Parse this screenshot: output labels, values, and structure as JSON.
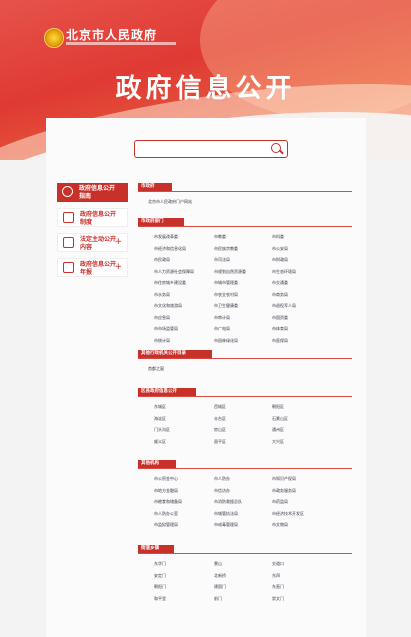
{
  "header": {
    "site_name": "北京市人民政府",
    "page_title": "政府信息公开"
  },
  "search": {
    "placeholder": ""
  },
  "sidebar": {
    "items": [
      {
        "label": "政府信息公开指南",
        "active": true,
        "expand": ""
      },
      {
        "label": "政府信息公开制度",
        "active": false,
        "expand": ""
      },
      {
        "label": "法定主动公开内容",
        "active": false,
        "expand": "+"
      },
      {
        "label": "政府信息公开年报",
        "active": false,
        "expand": "+"
      }
    ]
  },
  "sections": [
    {
      "title": "市政府",
      "items": [
        "北京市人民政府门户网站"
      ]
    },
    {
      "title": "市政府部门",
      "items": [
        "市发展改革委",
        "市教委",
        "市科委",
        "市经济和信息化局",
        "市民族宗教委",
        "市公安局",
        "市民政局",
        "市司法局",
        "市财政局",
        "市人力资源社会保障局",
        "市规划自然资源委",
        "市生态环境局",
        "市住房城乡建设委",
        "市城市管理委",
        "市交通委",
        "市水务局",
        "市农业农村局",
        "市商务局",
        "市文化和旅游局",
        "市卫生健康委",
        "市退役军人局",
        "市应急局",
        "市审计局",
        "市国资委",
        "市市场监管局",
        "市广电局",
        "市体育局",
        "市统计局",
        "市园林绿化局",
        "市医保局"
      ]
    },
    {
      "title": "其他行政机关公开目录",
      "items": [
        "首都之窗"
      ]
    },
    {
      "title": "区县政府信息公开",
      "items": [
        "东城区",
        "西城区",
        "朝阳区",
        "海淀区",
        "丰台区",
        "石景山区",
        "门头沟区",
        "房山区",
        "通州区",
        "顺义区",
        "昌平区",
        "大兴区"
      ]
    },
    {
      "title": "其他机构",
      "items": [
        "市公积金中心",
        "市人防办",
        "市知识产权局",
        "市地方金融局",
        "市信访办",
        "市政务服务局",
        "市粮食和储备局",
        "市消防救援总队",
        "市药监局",
        "市人防办公室",
        "市城管执法局",
        "市经济技术开发区",
        "市监狱管理局",
        "市戒毒管理局",
        "市文物局"
      ]
    },
    {
      "title": "街道乡镇",
      "items": [
        "东华门",
        "景山",
        "交道口",
        "安定门",
        "北新桥",
        "东四",
        "朝阳门",
        "建国门",
        "东直门",
        "和平里",
        "前门",
        "崇文门"
      ]
    }
  ]
}
